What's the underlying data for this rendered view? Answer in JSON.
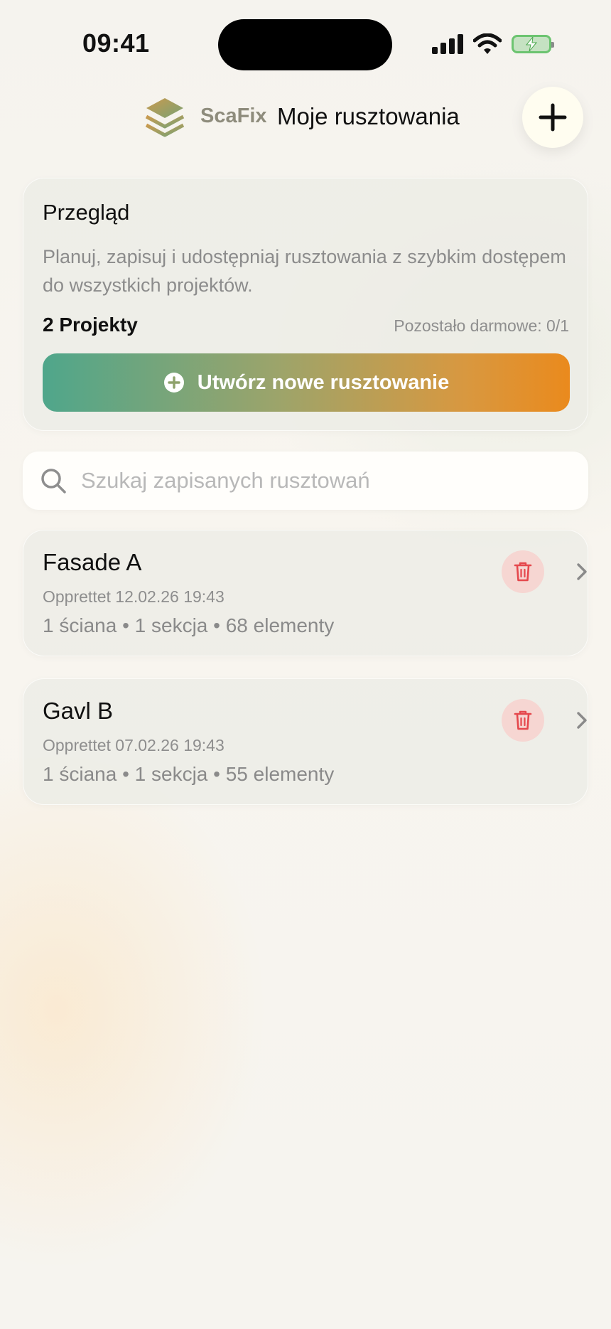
{
  "status_bar": {
    "time": "09:41"
  },
  "header": {
    "brand": "ScaFix",
    "title": "Moje rusztowania",
    "logo_icon": "stacked-layers-icon",
    "add_icon": "plus-icon"
  },
  "overview": {
    "title": "Przegląd",
    "description": "Planuj, zapisuj i udostępniaj rusztowania z szybkim dostępem do wszystkich projektów.",
    "project_count": "2 Projekty",
    "free_remaining": "Pozostało darmowe: 0/1",
    "create_button_label": "Utwórz nowe rusztowanie",
    "create_icon": "plus-circle-icon"
  },
  "search": {
    "placeholder": "Szukaj zapisanych rusztowań",
    "value": ""
  },
  "projects": [
    {
      "name": "Fasade A",
      "created": "Opprettet 12.02.26 19:43",
      "stats": "1 ściana • 1 sekcja • 68 elementy"
    },
    {
      "name": "Gavl B",
      "created": "Opprettet 07.02.26 19:43",
      "stats": "1 ściana • 1 sekcja • 55 elementy"
    }
  ],
  "colors": {
    "accent_start": "#4fa68b",
    "accent_end": "#ea8a1d",
    "delete_bg": "#f6d6d2",
    "delete_icon": "#e5484d",
    "battery": "#6cc470"
  }
}
